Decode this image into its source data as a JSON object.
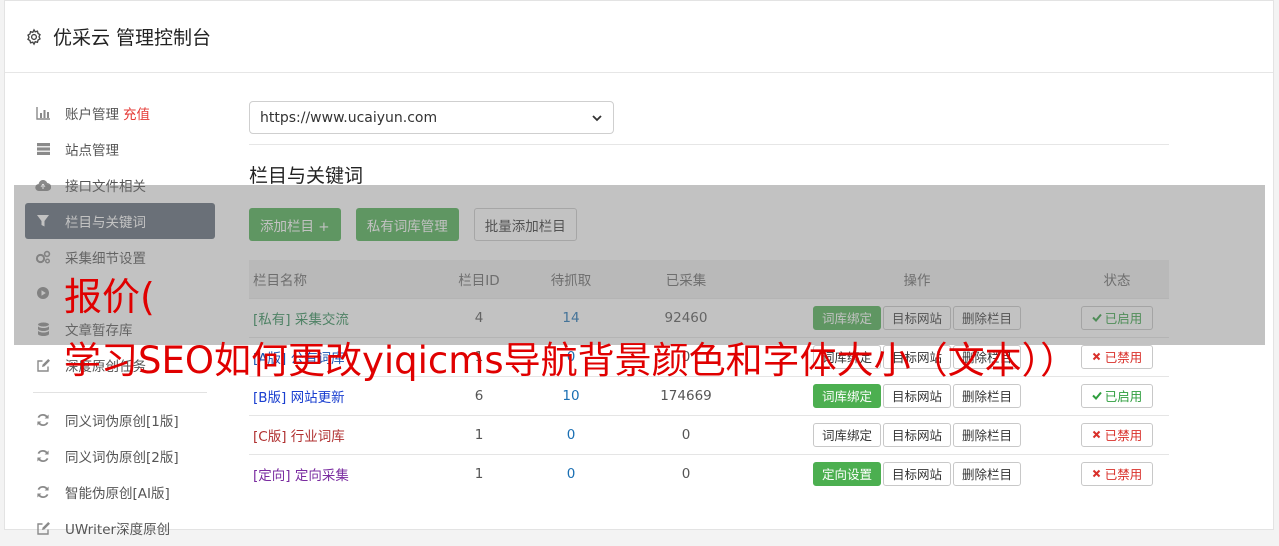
{
  "header": {
    "title": "优采云 管理控制台",
    "icon": "gear-icon"
  },
  "sidebar": {
    "items": [
      {
        "label": "账户管理",
        "badge": "充值",
        "icon": "bar-chart-icon"
      },
      {
        "label": "站点管理",
        "icon": "server-icon"
      },
      {
        "label": "接口文件相关",
        "icon": "cloud-upload-icon"
      },
      {
        "label": "栏目与关键词",
        "icon": "filter-icon",
        "active": true
      },
      {
        "label": "采集细节设置",
        "icon": "cogs-icon"
      },
      {
        "label": "",
        "icon": "play-circle-icon"
      },
      {
        "label": "文章暂存库",
        "icon": "database-icon"
      },
      {
        "label": "深度原创任务",
        "icon": "edit-icon"
      }
    ],
    "items2": [
      {
        "label": "同义词伪原创[1版]",
        "icon": "refresh-icon"
      },
      {
        "label": "同义词伪原创[2版]",
        "icon": "refresh-icon"
      },
      {
        "label": "智能伪原创[AI版]",
        "icon": "refresh-icon"
      },
      {
        "label": "UWriter深度原创",
        "icon": "edit-icon"
      }
    ]
  },
  "main": {
    "site_select": "https://www.ucaiyun.com",
    "section_title": "栏目与关键词",
    "buttons": {
      "add": "添加栏目 +",
      "private_lib": "私有词库管理",
      "batch_add": "批量添加栏目"
    },
    "table": {
      "headers": [
        "栏目名称",
        "栏目ID",
        "待抓取",
        "已采集",
        "操作",
        "状态"
      ],
      "rows": [
        {
          "tag": "[私有]",
          "name": "采集交流",
          "color": "#2e8b57",
          "id": "4",
          "pending": "14",
          "collected": "92460",
          "bind": "词库绑定",
          "bind_green": true,
          "target": "目标网站",
          "delete": "删除栏目",
          "status": "已启用",
          "enabled": true
        },
        {
          "tag": "[A版]",
          "name": "公有词库",
          "color": "#1a55b3",
          "id": "1",
          "pending": "0",
          "collected": "0",
          "bind": "词库绑定",
          "bind_green": false,
          "target": "目标网站",
          "delete": "删除栏目",
          "status": "已禁用",
          "enabled": false
        },
        {
          "tag": "[B版]",
          "name": "网站更新",
          "color": "#1a3fd0",
          "id": "6",
          "pending": "10",
          "collected": "174669",
          "bind": "词库绑定",
          "bind_green": true,
          "target": "目标网站",
          "delete": "删除栏目",
          "status": "已启用",
          "enabled": true
        },
        {
          "tag": "[C版]",
          "name": "行业词库",
          "color": "#b03030",
          "id": "1",
          "pending": "0",
          "collected": "0",
          "bind": "词库绑定",
          "bind_green": false,
          "target": "目标网站",
          "delete": "删除栏目",
          "status": "已禁用",
          "enabled": false
        },
        {
          "tag": "[定向]",
          "name": "定向采集",
          "color": "#7a2ca0",
          "id": "1",
          "pending": "0",
          "collected": "0",
          "bind": "定向设置",
          "bind_green": true,
          "target": "目标网站",
          "delete": "删除栏目",
          "status": "已禁用",
          "enabled": false
        }
      ]
    }
  },
  "overlay": {
    "line1": "报价(",
    "line2": "学习SEO如何更改yiqicms导航背景颜色和字体大小（文本））",
    "color": "#e00000"
  }
}
